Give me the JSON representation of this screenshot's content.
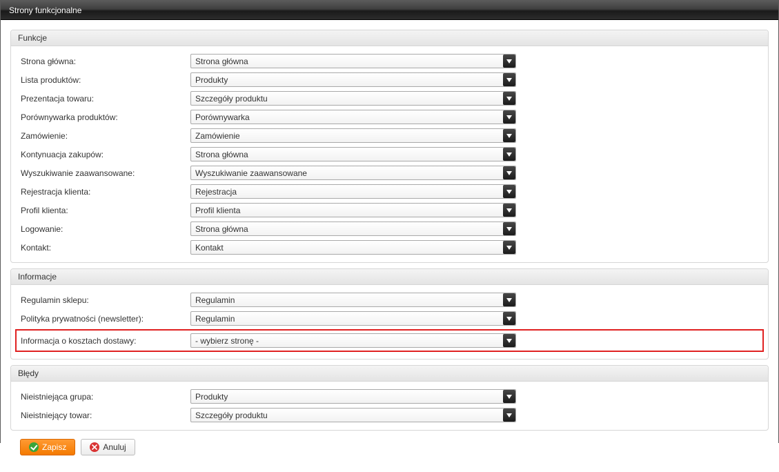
{
  "window": {
    "title": "Strony funkcjonalne"
  },
  "sections": {
    "funkcje": {
      "title": "Funkcje",
      "rows": [
        {
          "label": "Strona główna:",
          "value": "Strona główna"
        },
        {
          "label": "Lista produktów:",
          "value": "Produkty"
        },
        {
          "label": "Prezentacja towaru:",
          "value": "Szczegóły produktu"
        },
        {
          "label": "Porównywarka produktów:",
          "value": "Porównywarka"
        },
        {
          "label": "Zamówienie:",
          "value": "Zamówienie"
        },
        {
          "label": "Kontynuacja zakupów:",
          "value": "Strona główna"
        },
        {
          "label": "Wyszukiwanie zaawansowane:",
          "value": "Wyszukiwanie zaawansowane"
        },
        {
          "label": "Rejestracja klienta:",
          "value": "Rejestracja"
        },
        {
          "label": "Profil klienta:",
          "value": "Profil klienta"
        },
        {
          "label": "Logowanie:",
          "value": "Strona główna"
        },
        {
          "label": "Kontakt:",
          "value": "Kontakt"
        }
      ]
    },
    "informacje": {
      "title": "Informacje",
      "rows": [
        {
          "label": "Regulamin sklepu:",
          "value": "Regulamin",
          "highlighted": false
        },
        {
          "label": "Polityka prywatności (newsletter):",
          "value": "Regulamin",
          "highlighted": false
        },
        {
          "label": "Informacja o kosztach dostawy:",
          "value": "- wybierz stronę -",
          "highlighted": true
        }
      ]
    },
    "bledy": {
      "title": "Błędy",
      "rows": [
        {
          "label": "Nieistniejąca grupa:",
          "value": "Produkty"
        },
        {
          "label": "Nieistniejący towar:",
          "value": "Szczegóły produktu"
        }
      ]
    }
  },
  "buttons": {
    "save": "Zapisz",
    "cancel": "Anuluj"
  }
}
